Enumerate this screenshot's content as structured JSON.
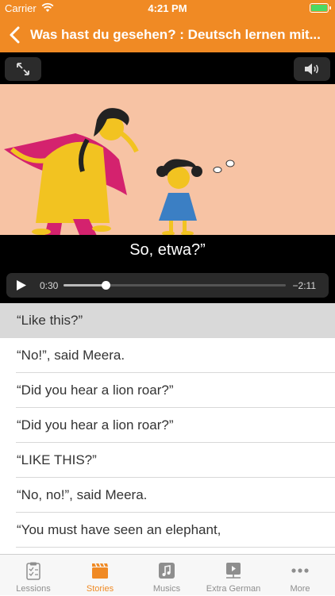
{
  "status": {
    "carrier": "Carrier",
    "time": "4:21 PM"
  },
  "nav": {
    "title": "Was hast du gesehen? : Deutsch lernen mit..."
  },
  "player": {
    "subtitle": "So, etwa?”",
    "current_time": "0:30",
    "remaining_time": "−2:11",
    "progress": 0.19
  },
  "sentences": [
    "“Like this?”",
    "“No!”, said Meera.",
    "“Did you hear a lion roar?”",
    "“Did you hear a lion roar?”",
    "“LIKE THIS?”",
    "“No, no!”, said Meera.",
    "“You must have seen an elephant,"
  ],
  "tabs": [
    {
      "label": "Lessions",
      "icon": "clipboard-icon"
    },
    {
      "label": "Stories",
      "icon": "clapperboard-icon"
    },
    {
      "label": "Musics",
      "icon": "music-note-icon"
    },
    {
      "label": "Extra German",
      "icon": "video-icon"
    },
    {
      "label": "More",
      "icon": "more-dots-icon"
    }
  ],
  "colors": {
    "accent": "#f08a24",
    "illustration_bg": "#f7c3a4"
  }
}
